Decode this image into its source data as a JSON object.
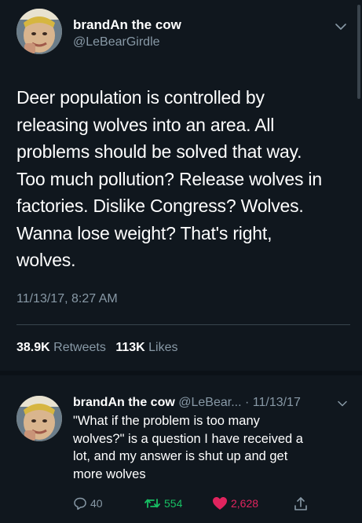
{
  "tweet": {
    "author_name": "brandAn the cow",
    "author_handle": "@LeBearGirdle",
    "text_lines": [
      "Deer population is controlled by",
      "releasing wolves into an area. All",
      "problems should be solved that way.",
      "Too much pollution? Release wolves in",
      "factories. Dislike Congress? Wolves.",
      "Wanna lose weight? That's right,",
      "wolves."
    ],
    "timestamp": "11/13/17, 8:27 AM",
    "retweets_count": "38.9K",
    "retweets_label": "Retweets",
    "likes_count": "113K",
    "likes_label": "Likes"
  },
  "reply": {
    "author_name": "brandAn the cow",
    "author_handle": "@LeBear...",
    "date": "· 11/13/17",
    "text_lines": [
      "\"What if the problem is too many",
      "wolves?\" is a question I have received a",
      "lot, and my answer is shut up and get",
      "more wolves"
    ],
    "reply_count": "40",
    "retweet_count": "554",
    "like_count": "2,628"
  },
  "colors": {
    "background": "#10171e",
    "secondary_text": "#8899a6",
    "retweet_green": "#17bf63",
    "like_red": "#e0245e"
  },
  "icons": [
    "chevron-down-icon",
    "reply-icon",
    "retweet-icon",
    "heart-icon",
    "share-icon"
  ]
}
